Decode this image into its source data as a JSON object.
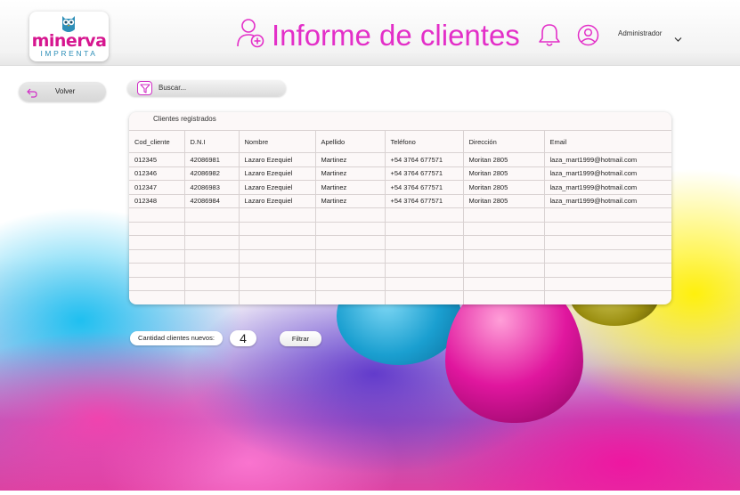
{
  "brand": {
    "name": "minerva",
    "subtitle": "IMPRENTA"
  },
  "header": {
    "title": "Informe de clientes",
    "user_label": "Administrador"
  },
  "controls": {
    "back_label": "Volver",
    "search_placeholder": "Buscar..."
  },
  "table": {
    "caption": "Clientes registrados",
    "columns": [
      "Cod_cliente",
      "D.N.I",
      "Nombre",
      "Apellido",
      "Teléfono",
      "Dirección",
      "Email"
    ],
    "rows": [
      [
        "012345",
        "42086981",
        "Lazaro Ezequiel",
        "Martinez",
        "+54 3764 677571",
        "Moritan 2805",
        "laza_mart1999@hotmail.com"
      ],
      [
        "012346",
        "42086982",
        "Lazaro Ezequiel",
        "Martinez",
        "+54 3764 677571",
        "Moritan 2805",
        "laza_mart1999@hotmail.com"
      ],
      [
        "012347",
        "42086983",
        "Lazaro Ezequiel",
        "Martinez",
        "+54 3764 677571",
        "Moritan 2805",
        "laza_mart1999@hotmail.com"
      ],
      [
        "012348",
        "42086984",
        "Lazaro Ezequiel",
        "Martinez",
        "+54 3764 677571",
        "Moritan 2805",
        "laza_mart1999@hotmail.com"
      ]
    ],
    "empty_rows": 7
  },
  "footer": {
    "count_label": "Cantidad clientes nuevos:",
    "count_value": "4",
    "filter_label": "Filtrar"
  },
  "colors": {
    "accent": "#e32fc8",
    "brand_pink": "#d6168f",
    "brand_blue": "#2e8fb8"
  },
  "icons": {
    "logo": "owl-icon",
    "title": "add-user-icon",
    "notifications": "bell-icon",
    "account": "user-circle-icon",
    "menu": "chevron-down-icon",
    "back": "return-arrow-icon",
    "search": "filter-funnel-icon"
  }
}
